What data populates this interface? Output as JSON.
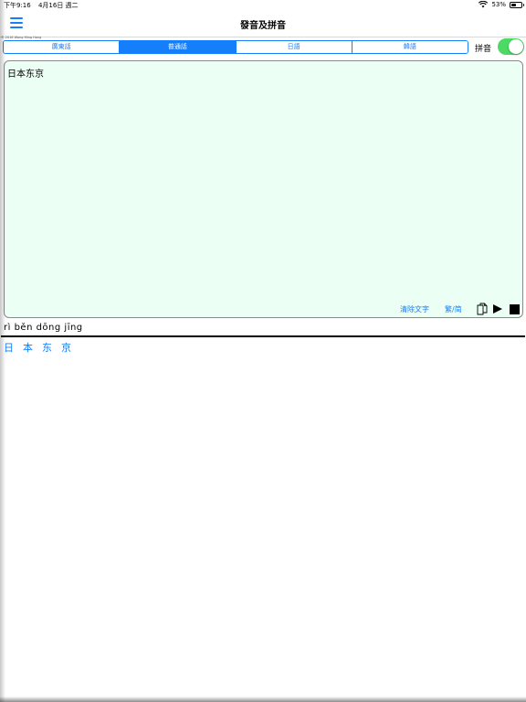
{
  "status_bar": {
    "time": "下午9:16",
    "date": "4月16日 週二",
    "battery": "53%",
    "battery_level": 0.53
  },
  "nav": {
    "title": "發音及拼音"
  },
  "copyright": "© 2016 Wong Ming Hong",
  "segments": [
    {
      "label": "廣東話",
      "active": false
    },
    {
      "label": "普通話",
      "active": true
    },
    {
      "label": "日語",
      "active": false
    },
    {
      "label": "韓語",
      "active": false
    }
  ],
  "pinyin_toggle": {
    "label": "拼音",
    "on": true
  },
  "editor": {
    "text": "日本东京",
    "clear_label": "清除文字",
    "convert_label": "繁/简"
  },
  "result": {
    "pinyin": "rì běn dōng jīng",
    "characters": [
      "日",
      "本",
      "东",
      "京"
    ]
  },
  "colors": {
    "accent": "#147efb",
    "toggle_on": "#4cd964",
    "editor_bg": "#ebfff4"
  },
  "icons": [
    "menu-icon",
    "wifi-icon",
    "battery-icon",
    "copy-icon",
    "play-icon",
    "stop-icon"
  ]
}
